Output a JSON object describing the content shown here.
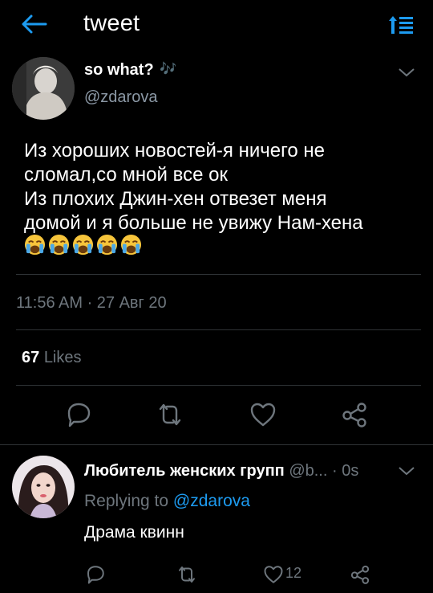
{
  "header": {
    "title": "tweet",
    "back_icon": "arrow-left-icon",
    "sort_icon": "sort-icon",
    "accent": "#1d9bf0"
  },
  "tweet": {
    "author_name": "so what?",
    "author_name_glyph": "🎶",
    "author_handle": "@zdarova",
    "text_lines": [
      "Из хороших новостей-я ничего не",
      "сломал,со мной все ок",
      "Из плохих Джин-хен отвезет меня",
      "домой и я больше не увижу Нам-хена"
    ],
    "emoji": [
      "😭",
      "😭",
      "😭",
      "😭",
      "😭"
    ],
    "timestamp": "11:56 AM · 27 Авг 20",
    "likes_count": "67",
    "likes_label": "Likes",
    "actions": [
      "reply-icon",
      "retweet-icon",
      "like-icon",
      "share-icon"
    ]
  },
  "reply": {
    "author_name": "Любитель женских групп",
    "meta": "@b... · 0s",
    "replying_prefix": "Replying to",
    "replying_handle": "@zdarova",
    "text": "Драма квинн",
    "like_count": "12",
    "actions": [
      "reply-icon",
      "retweet-icon",
      "like-icon",
      "share-icon"
    ]
  },
  "colors": {
    "background": "#000000",
    "text": "#ffffff",
    "muted": "#6e767d",
    "link": "#1d9bf0",
    "divider": "#2f3336"
  }
}
